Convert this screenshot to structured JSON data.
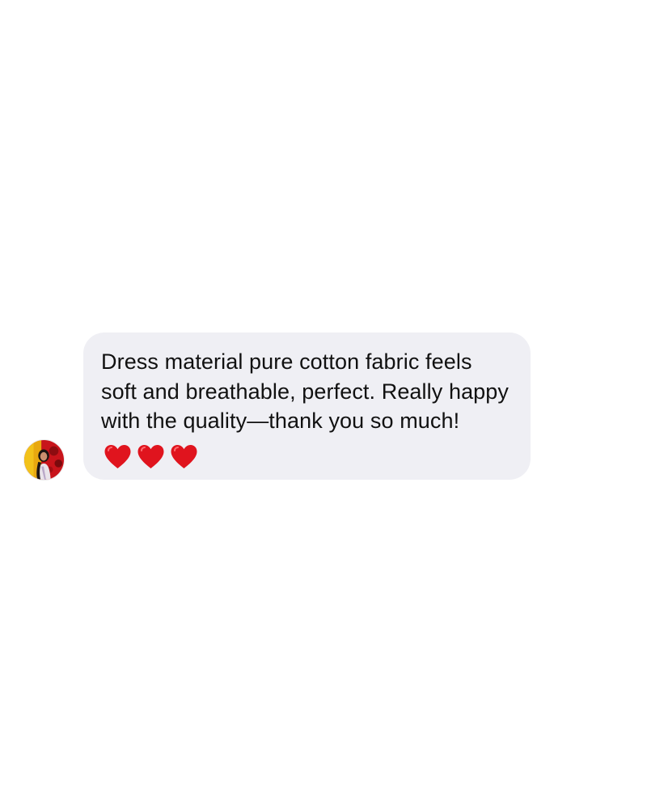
{
  "conversation": {
    "message": {
      "sender_avatar": "avatar-photo",
      "text": "Dress material pure cotton fabric feels soft and breathable, perfect. Really happy with the quality—thank you so much!",
      "emoji": [
        "heart-icon",
        "heart-icon",
        "heart-icon"
      ]
    }
  },
  "colors": {
    "bubble_background": "#efeff4",
    "text": "#111111",
    "heart": "#e0141e",
    "background": "#ffffff"
  }
}
